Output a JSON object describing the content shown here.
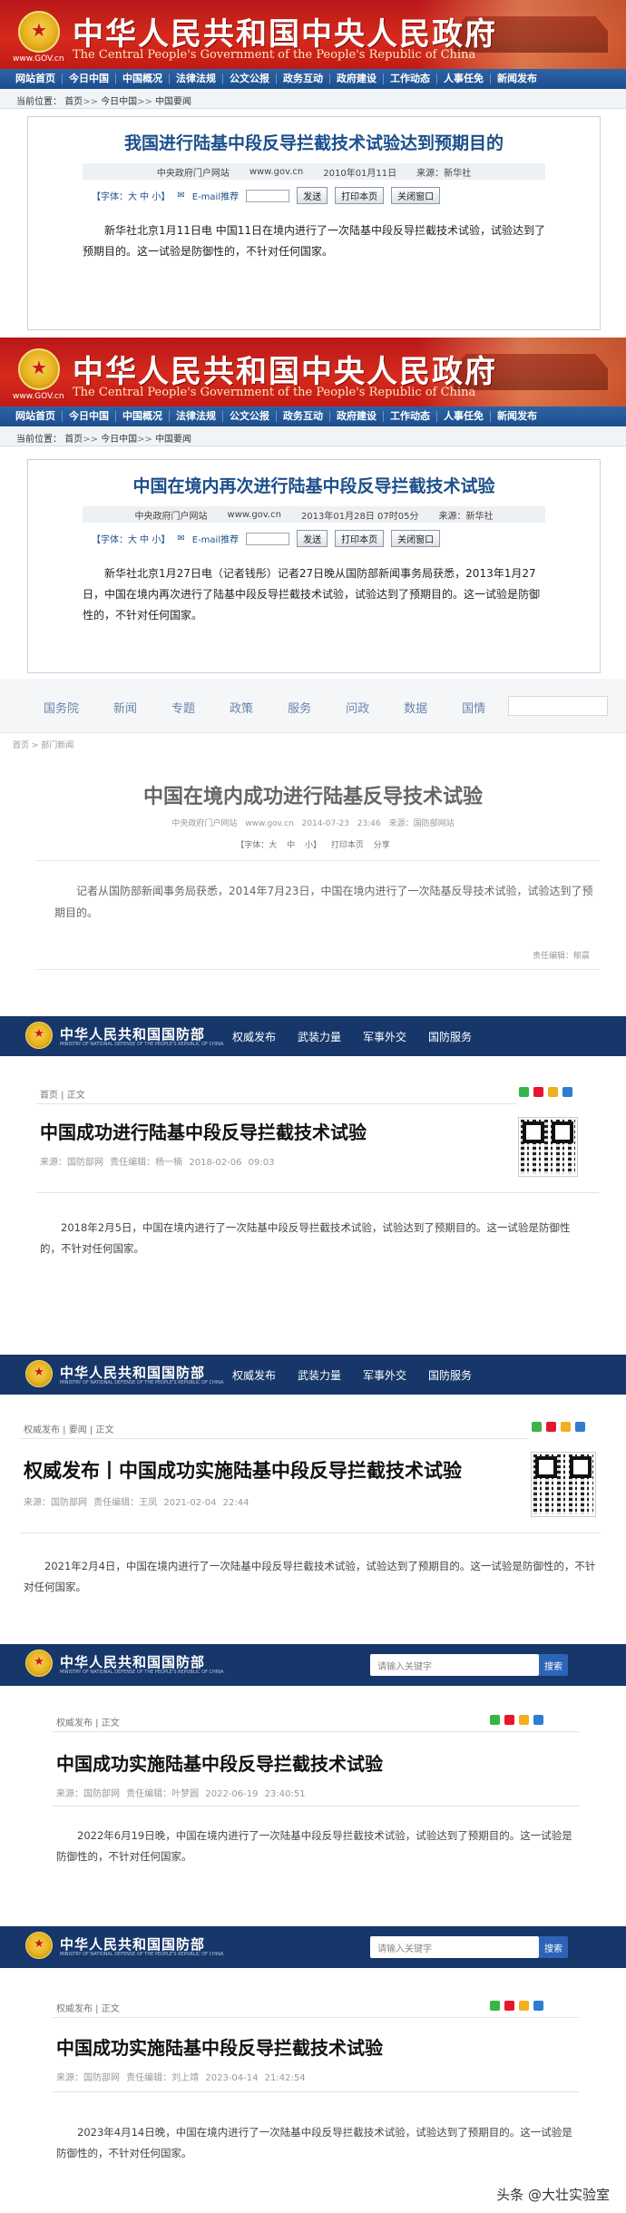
{
  "panel1": {
    "banner": {
      "title": "中华人民共和国中央人民政府",
      "subtitle": "The Central People's Government of the People's Republic of China",
      "url": "www.GOV.cn"
    },
    "nav": [
      "网站首页",
      "今日中国",
      "中国概况",
      "法律法规",
      "公文公报",
      "政务互动",
      "政府建设",
      "工作动态",
      "人事任免",
      "新闻发布"
    ],
    "crumb": {
      "label": "当前位置：",
      "items": [
        "首页",
        "今日中国",
        "中国要闻"
      ]
    },
    "headline": "我国进行陆基中段反导拦截技术试验达到预期目的",
    "meta": {
      "source": "中央政府门户网站",
      "site": "www.gov.cn",
      "date": "2010年01月11日",
      "origin": "来源：新华社"
    },
    "tools": {
      "font": "【字体：大 中 小】",
      "email": "E-mail推荐",
      "send": "发送",
      "print": "打印本页",
      "close": "关闭窗口"
    },
    "body": "新华社北京1月11日电 中国11日在境内进行了一次陆基中段反导拦截技术试验，试验达到了预期目的。这一试验是防御性的，不针对任何国家。"
  },
  "panel2": {
    "banner": {
      "title": "中华人民共和国中央人民政府",
      "subtitle": "The Central People's Government of the People's Republic of China",
      "url": "www.GOV.cn"
    },
    "nav": [
      "网站首页",
      "今日中国",
      "中国概况",
      "法律法规",
      "公文公报",
      "政务互动",
      "政府建设",
      "工作动态",
      "人事任免",
      "新闻发布"
    ],
    "crumb": {
      "label": "当前位置：",
      "items": [
        "首页",
        "今日中国",
        "中国要闻"
      ]
    },
    "headline": "中国在境内再次进行陆基中段反导拦截技术试验",
    "meta": {
      "source": "中央政府门户网站",
      "site": "www.gov.cn",
      "date": "2013年01月28日 07时05分",
      "origin": "来源：新华社"
    },
    "tools": {
      "font": "【字体：大 中 小】",
      "email": "E-mail推荐",
      "send": "发送",
      "print": "打印本页",
      "close": "关闭窗口"
    },
    "body": "新华社北京1月27日电（记者钱彤）记者27日晚从国防部新闻事务局获悉，2013年1月27日，中国在境内再次进行了陆基中段反导拦截技术试验，试验达到了预期目的。这一试验是防御性的，不针对任何国家。"
  },
  "panel3": {
    "nav": [
      "国务院",
      "新闻",
      "专题",
      "政策",
      "服务",
      "问政",
      "数据",
      "国情"
    ],
    "crumb": "首页 > 部门新闻",
    "headline": "中国在境内成功进行陆基反导技术试验",
    "meta": "中央政府门户网站 www.gov.cn 2014-07-23 23:46 来源：国防部网站",
    "tools": "【字体：大 中 小】 打印本页 分享",
    "body": "记者从国防部新闻事务局获悉，2014年7月23日，中国在境内进行了一次陆基反导技术试验，试验达到了预期目的。",
    "editor": "责任编辑：郁晨"
  },
  "panel4": {
    "brand": {
      "name": "中华人民共和国国防部",
      "en": "MINISTRY OF NATIONAL DEFENSE OF THE PEOPLE'S REPUBLIC OF CHINA"
    },
    "nav": [
      "权威发布",
      "武装力量",
      "军事外交",
      "国防服务"
    ],
    "crumb": "首页 | 正文",
    "headline": "中国成功进行陆基中段反导拦截技术试验",
    "meta": "来源：国防部网 责任编辑：杨一楠 2018-02-06 09:03",
    "body": "2018年2月5日，中国在境内进行了一次陆基中段反导拦截技术试验，试验达到了预期目的。这一试验是防御性的，不针对任何国家。"
  },
  "panel5": {
    "brand": {
      "name": "中华人民共和国国防部",
      "en": "MINISTRY OF NATIONAL DEFENSE OF THE PEOPLE'S REPUBLIC OF CHINA"
    },
    "nav": [
      "权威发布",
      "武装力量",
      "军事外交",
      "国防服务"
    ],
    "crumb": "权威发布 | 要闻 | 正文",
    "headline": "权威发布丨中国成功实施陆基中段反导拦截技术试验",
    "meta": "来源：国防部网 责任编辑：王凤 2021-02-04 22:44",
    "body": "2021年2月4日，中国在境内进行了一次陆基中段反导拦截技术试验，试验达到了预期目的。这一试验是防御性的，不针对任何国家。"
  },
  "panel6": {
    "brand": {
      "name": "中华人民共和国国防部",
      "en": "MINISTRY OF NATIONAL DEFENSE OF THE PEOPLE'S REPUBLIC OF CHINA"
    },
    "search": {
      "placeholder": "请输入关键字",
      "button": "搜索"
    },
    "crumb": "权威发布 | 正文",
    "headline": "中国成功实施陆基中段反导拦截技术试验",
    "meta": "来源：国防部网 责任编辑：叶梦圆 2022-06-19 23:40:51",
    "body": "2022年6月19日晚，中国在境内进行了一次陆基中段反导拦截技术试验，试验达到了预期目的。这一试验是防御性的，不针对任何国家。"
  },
  "panel7": {
    "brand": {
      "name": "中华人民共和国国防部",
      "en": "MINISTRY OF NATIONAL DEFENSE OF THE PEOPLE'S REPUBLIC OF CHINA"
    },
    "search": {
      "placeholder": "请输入关键字",
      "button": "搜索"
    },
    "crumb": "权威发布 | 正文",
    "headline": "中国成功实施陆基中段反导拦截技术试验",
    "meta": "来源：国防部网 责任编辑：刘上靖 2023-04-14 21:42:54",
    "body": "2023年4月14日晚，中国在境内进行了一次陆基中段反导拦截技术试验，试验达到了预期目的。这一试验是防御性的，不针对任何国家。"
  },
  "watermark": "头条 @大壮实验室",
  "colors": {
    "gov_red": "#c8161d",
    "gov_blue": "#1c4f8b",
    "mod_navy": "#17376b",
    "search_blue": "#2d63b8"
  }
}
